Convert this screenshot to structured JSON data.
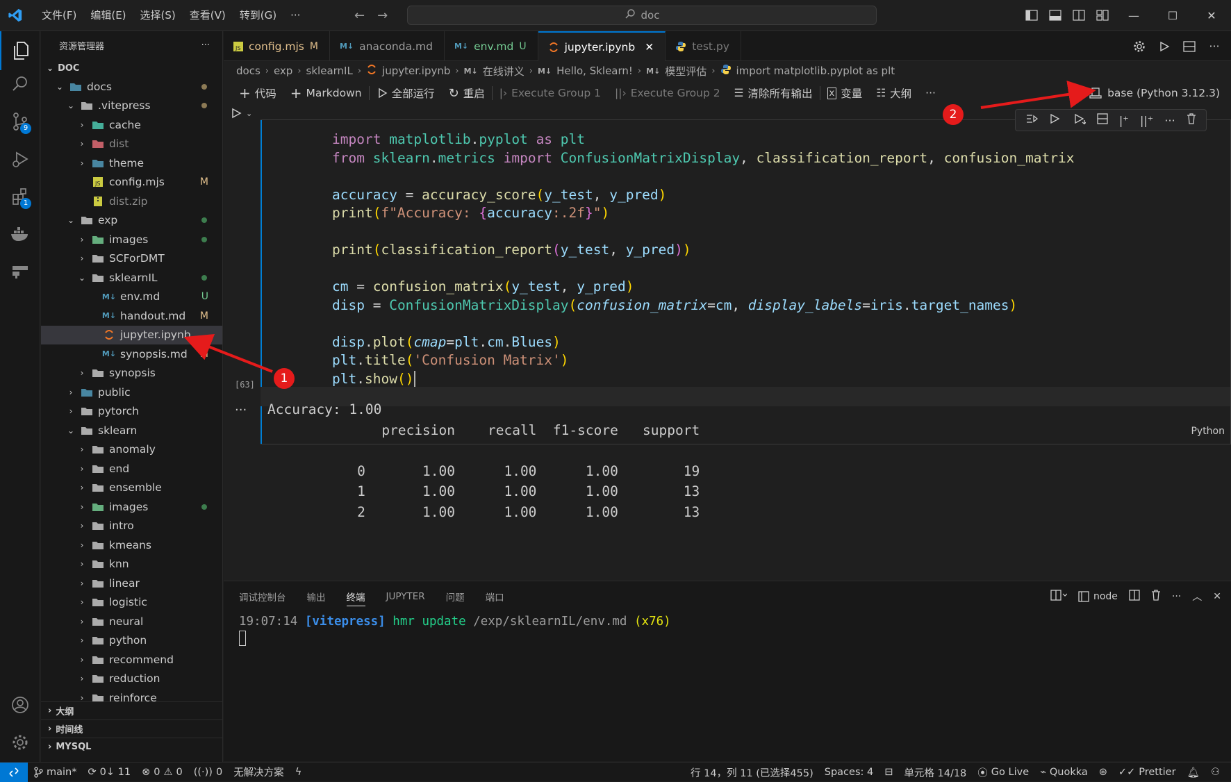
{
  "titlebar": {
    "menu": [
      "文件(F)",
      "编辑(E)",
      "选择(S)",
      "查看(V)",
      "转到(G)",
      "···"
    ],
    "search": "doc"
  },
  "activity": {
    "source_control_badge": "9",
    "extensions_badge": "1"
  },
  "sidebar": {
    "title": "资源管理器",
    "more": "···",
    "root": "DOC",
    "tree": [
      {
        "name": "docs",
        "depth": 0,
        "type": "folder",
        "open": true
      },
      {
        "name": ".vitepress",
        "depth": 1,
        "type": "folder",
        "open": true
      },
      {
        "name": "cache",
        "depth": 2,
        "type": "folder",
        "open": false
      },
      {
        "name": "dist",
        "depth": 2,
        "type": "folder",
        "open": false
      },
      {
        "name": "theme",
        "depth": 2,
        "type": "folder",
        "open": false
      },
      {
        "name": "config.mjs",
        "depth": 2,
        "type": "js",
        "status": "M"
      },
      {
        "name": "dist.zip",
        "depth": 2,
        "type": "zip"
      },
      {
        "name": "exp",
        "depth": 1,
        "type": "folder",
        "open": true
      },
      {
        "name": "images",
        "depth": 2,
        "type": "folder",
        "open": false
      },
      {
        "name": "SCForDMT",
        "depth": 2,
        "type": "folder",
        "open": false
      },
      {
        "name": "sklearnIL",
        "depth": 2,
        "type": "folder",
        "open": true
      },
      {
        "name": "env.md",
        "depth": 3,
        "type": "md",
        "status": "U"
      },
      {
        "name": "handout.md",
        "depth": 3,
        "type": "md",
        "status": "M"
      },
      {
        "name": "jupyter.ipynb",
        "depth": 3,
        "type": "ipynb",
        "selected": true
      },
      {
        "name": "synopsis.md",
        "depth": 3,
        "type": "md",
        "status": "M"
      },
      {
        "name": "synopsis",
        "depth": 2,
        "type": "folder",
        "open": false
      },
      {
        "name": "public",
        "depth": 1,
        "type": "folder",
        "open": false
      },
      {
        "name": "pytorch",
        "depth": 1,
        "type": "folder",
        "open": false
      },
      {
        "name": "sklearn",
        "depth": 1,
        "type": "folder",
        "open": true
      },
      {
        "name": "anomaly",
        "depth": 2,
        "type": "folder",
        "open": false
      },
      {
        "name": "end",
        "depth": 2,
        "type": "folder",
        "open": false
      },
      {
        "name": "ensemble",
        "depth": 2,
        "type": "folder",
        "open": false
      },
      {
        "name": "images",
        "depth": 2,
        "type": "folder",
        "open": false
      },
      {
        "name": "intro",
        "depth": 2,
        "type": "folder",
        "open": false
      },
      {
        "name": "kmeans",
        "depth": 2,
        "type": "folder",
        "open": false
      },
      {
        "name": "knn",
        "depth": 2,
        "type": "folder",
        "open": false
      },
      {
        "name": "linear",
        "depth": 2,
        "type": "folder",
        "open": false
      },
      {
        "name": "logistic",
        "depth": 2,
        "type": "folder",
        "open": false
      },
      {
        "name": "neural",
        "depth": 2,
        "type": "folder",
        "open": false
      },
      {
        "name": "python",
        "depth": 2,
        "type": "folder",
        "open": false
      },
      {
        "name": "recommend",
        "depth": 2,
        "type": "folder",
        "open": false
      },
      {
        "name": "reduction",
        "depth": 2,
        "type": "folder",
        "open": false
      },
      {
        "name": "reinforce",
        "depth": 2,
        "type": "folder",
        "open": false
      }
    ],
    "outline": "大纲",
    "timeline": "时间线",
    "mysql": "MYSQL"
  },
  "tabs": [
    {
      "label": "config.mjs",
      "status": "M",
      "icon": "js"
    },
    {
      "label": "anaconda.md",
      "status": "",
      "icon": "md"
    },
    {
      "label": "env.md",
      "status": "U",
      "icon": "md"
    },
    {
      "label": "jupyter.ipynb",
      "status": "",
      "icon": "ipynb",
      "active": true
    },
    {
      "label": "test.py",
      "status": "",
      "icon": "py"
    }
  ],
  "breadcrumbs": [
    "docs",
    "exp",
    "sklearnIL",
    "jupyter.ipynb",
    "在线讲义",
    "Hello, Sklearn!",
    "模型评估",
    "import matplotlib.pyplot as plt"
  ],
  "notebook_toolbar": {
    "code": "代码",
    "markdown": "Markdown",
    "run_all": "全部运行",
    "restart": "重启",
    "exec_group_1": "Execute Group 1",
    "exec_group_2": "Execute Group 2",
    "clear_outputs": "清除所有输出",
    "variables": "变量",
    "outline": "大纲",
    "more": "···",
    "kernel": "base (Python 3.12.3)"
  },
  "cell": {
    "exec_count": "[63]",
    "language": "Python"
  },
  "output": {
    "dots": "···",
    "lines": [
      "Accuracy: 1.00",
      "              precision    recall  f1-score   support",
      "",
      "           0       1.00      1.00      1.00        19",
      "           1       1.00      1.00      1.00        13",
      "           2       1.00      1.00      1.00        13"
    ]
  },
  "panel": {
    "tabs": [
      "调试控制台",
      "输出",
      "终端",
      "JUPYTER",
      "问题",
      "端口"
    ],
    "active_tab": "终端",
    "terminal_name": "node",
    "term_time": "19:07:14",
    "term_tag": "[vitepress]",
    "term_cmd": "hmr update",
    "term_path": "/exp/sklearnIL/env.md",
    "term_count": "(x76)"
  },
  "status": {
    "branch": "main*",
    "sync": "0↓ 11",
    "errors": "0",
    "warnings": "0",
    "ports": "0",
    "solution": "无解决方案",
    "cursor": "行 14，列 11 (已选择455)",
    "spaces": "Spaces: 4",
    "cell_pos": "单元格 14/18",
    "golive": "Go Live",
    "quokka": "Quokka",
    "prettier": "Prettier"
  },
  "annotations": [
    "1",
    "2"
  ],
  "colors": {
    "accent": "#0078d4",
    "marker": "#e51b1b"
  }
}
